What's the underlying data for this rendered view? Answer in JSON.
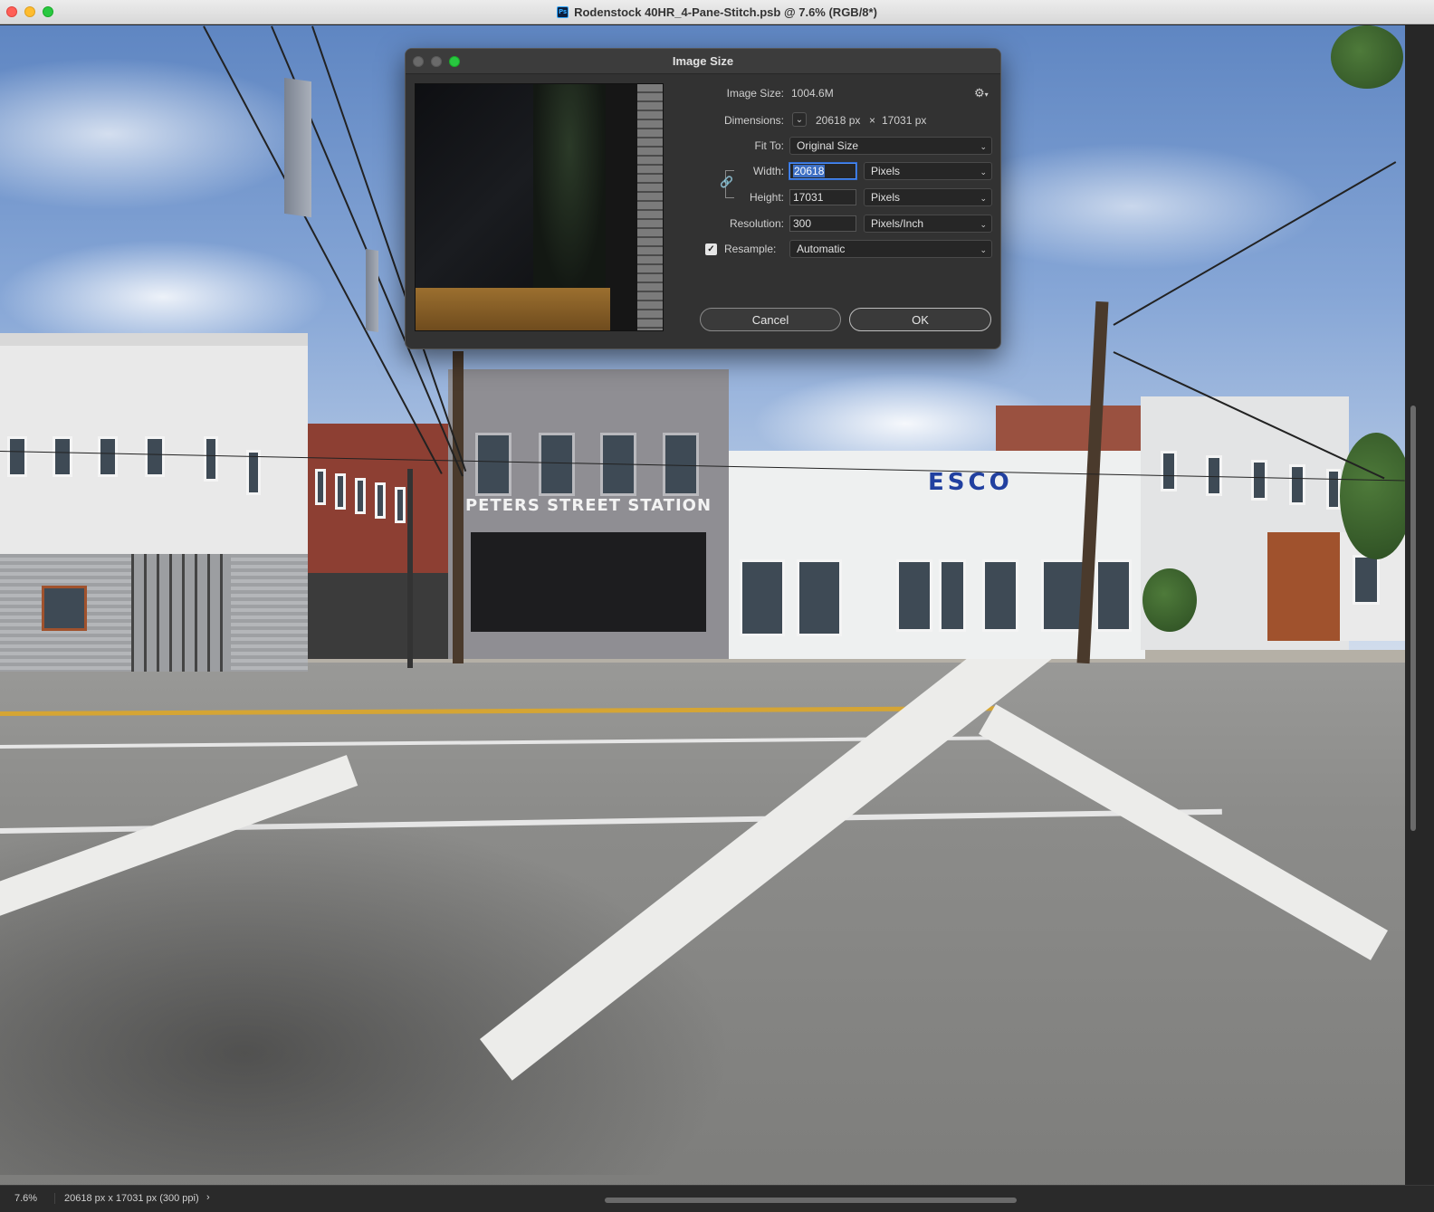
{
  "window": {
    "title": "Rodenstock 40HR_4-Pane-Stitch.psb @ 7.6% (RGB/8*)",
    "app_icon": "Ps"
  },
  "canvas": {
    "sign_text": "PETERS STREET STATION",
    "store_logo": "ESCO"
  },
  "dialog": {
    "title": "Image Size",
    "image_size_label": "Image Size:",
    "image_size_value": "1004.6M",
    "dimensions_label": "Dimensions:",
    "dimensions_width": "20618 px",
    "dimensions_x": "×",
    "dimensions_height": "17031 px",
    "fit_to_label": "Fit To:",
    "fit_to_value": "Original Size",
    "width_label": "Width:",
    "width_value": "20618",
    "width_unit": "Pixels",
    "height_label": "Height:",
    "height_value": "17031",
    "height_unit": "Pixels",
    "resolution_label": "Resolution:",
    "resolution_value": "300",
    "resolution_unit": "Pixels/Inch",
    "resample_label": "Resample:",
    "resample_checked": true,
    "resample_value": "Automatic",
    "cancel_label": "Cancel",
    "ok_label": "OK"
  },
  "status": {
    "zoom": "7.6%",
    "doc_info": "20618 px x 17031 px (300 ppi)"
  },
  "icons": {
    "settings": "gear-icon",
    "constrain": "link-icon",
    "dropdown": "chevron-down-icon"
  }
}
